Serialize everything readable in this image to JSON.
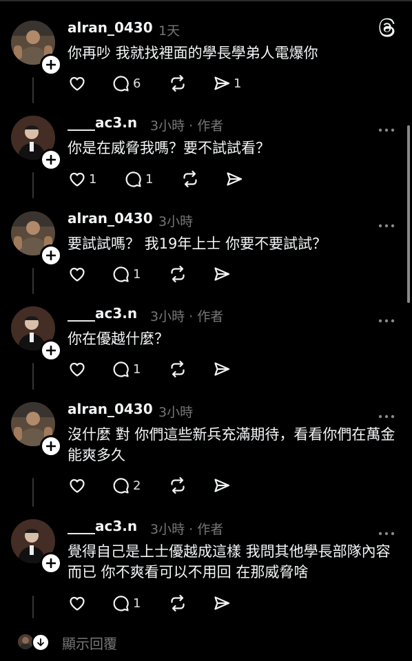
{
  "app_icon": "threads-logo-icon",
  "posts": [
    {
      "username": "alran_0430",
      "time": "1天",
      "author_tag": "",
      "text": "你再吵 我就找裡面的學長學弟人電爆你",
      "likes": "",
      "replies": "6",
      "reposts": "",
      "shares": "1",
      "avatar": "avatar-a"
    },
    {
      "username": "____ac3.n",
      "time": "3小時",
      "author_tag": "· 作者",
      "text": "你是在威脅我嗎？要不試試看？",
      "likes": "1",
      "replies": "1",
      "reposts": "",
      "shares": "",
      "avatar": "avatar-b"
    },
    {
      "username": "alran_0430",
      "time": "3小時",
      "author_tag": "",
      "text": "要試試嗎？ 我19年上士 你要不要試試？",
      "likes": "",
      "replies": "1",
      "reposts": "",
      "shares": "",
      "avatar": "avatar-a"
    },
    {
      "username": "____ac3.n",
      "time": "3小時",
      "author_tag": "· 作者",
      "text": "你在優越什麼？",
      "likes": "",
      "replies": "1",
      "reposts": "",
      "shares": "",
      "avatar": "avatar-b"
    },
    {
      "username": "alran_0430",
      "time": "3小時",
      "author_tag": "",
      "text": "沒什麼 對 你們這些新兵充滿期待，看看你們在萬金能爽多久",
      "likes": "",
      "replies": "2",
      "reposts": "",
      "shares": "",
      "avatar": "avatar-a"
    },
    {
      "username": "____ac3.n",
      "time": "3小時",
      "author_tag": "· 作者",
      "text": "覺得自己是上士優越成這樣 我問其他學長部隊內容而已 你不爽看可以不用回 在那威脅啥",
      "likes": "",
      "replies": "1",
      "reposts": "",
      "shares": "",
      "avatar": "avatar-b"
    }
  ],
  "show_replies_label": "顯示回覆",
  "colors": {
    "background": "#000000",
    "text": "#f3f5f7",
    "muted": "#777777",
    "thread_line": "#333638"
  }
}
